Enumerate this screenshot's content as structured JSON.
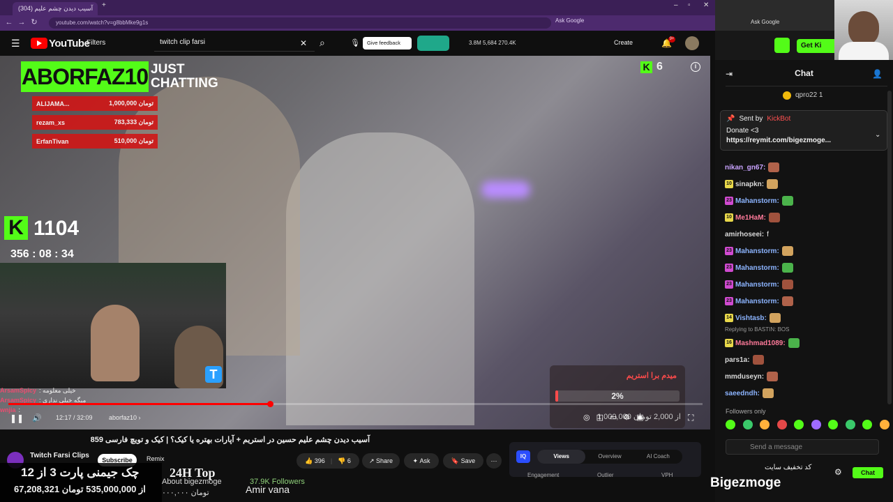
{
  "browser": {
    "tab_title": "(304) آسیب دیدن چشم عليم",
    "url": "youtube.com/watch?v=g8bbMke9g1s",
    "ask_google": "Ask Google",
    "ask_google_right": "Ask Google"
  },
  "youtube": {
    "logo_text": "YouTube",
    "filters": "Filters",
    "search_value": "twitch clip farsi",
    "feedback": "Give feedback",
    "stats": "3.8M   5,684   270.4K",
    "create": "Create",
    "notif_count": "9+"
  },
  "video": {
    "banner_name": "ABORFAZ10",
    "banner_category": "JUST CHATTING",
    "donors": [
      {
        "name": "ALIJAMA...",
        "amount": "1,000,000 تومان"
      },
      {
        "name": "rezam_xs",
        "amount": "783,333 تومان"
      },
      {
        "name": "ErfanTivan",
        "amount": "510,000 تومان"
      }
    ],
    "viewer_count": "1104",
    "timer": "356 : 08 : 34",
    "kick_viewers": "6",
    "overlay_chat": [
      {
        "user": "ArsamSpicy",
        "text": ": خیلی معلومه"
      },
      {
        "user": "ArsamSpicy",
        "text": ": میگه خیلی نداری"
      },
      {
        "user": "wnjia",
        "text": ":"
      }
    ],
    "goal_title": "میدم برا استریم",
    "goal_percent": "2%",
    "goal_progress": 0.02,
    "goal_amount": "1,000,000 از 2,000 تومان",
    "progress": 0.3764,
    "time": "12:17 / 32:09",
    "channel_chip": "aborfaz10 ›"
  },
  "below": {
    "title": "آسیب دیدن چشم علیم حسین در استریم + آپارات بهتره یا کیک؟ | کیک و تویچ فارسی 859",
    "channel": "Twitch Farsi Clips",
    "subscribe": "Subscribe",
    "remix": "Remix",
    "likes": "396",
    "dislikes": "6",
    "share": "Share",
    "ask": "Ask",
    "save": "Save",
    "vidiq_logo": "IQ",
    "vq_tabs": [
      "Views",
      "Overview",
      "AI Coach"
    ],
    "vq_engagement": "Engagement",
    "vq_outlier": "Outlier",
    "vq_vph": "VPH"
  },
  "ad": {
    "line1": "چک جیمنی پارت 3 از 12",
    "line2": "67,208,321 از 535,000,000 تومان",
    "top24": "24H Top",
    "about": "About bigezmoge",
    "followers": "37.9K Followers",
    "amir": "Amir vana",
    "toman": "۰۰۰,۰۰۰ تومان"
  },
  "kick_chat": {
    "get_kick": "Get Ki",
    "title": "Chat",
    "top_user": "qpro22",
    "top_badge": "1",
    "pinned_sent_by": "Sent by",
    "pinned_bot": "KickBot",
    "pinned_text": "Donate <3",
    "pinned_link": "https://reymit.com/bigezmoge...",
    "messages": [
      {
        "user": "nikan_gn67:",
        "cls": "u1",
        "badge": "",
        "badgeColor": "",
        "text": ""
      },
      {
        "user": "sinapkn:",
        "cls": "u4",
        "badge": "10",
        "badgeColor": "#e8d84a",
        "text": ""
      },
      {
        "user": "Mahanstorm:",
        "cls": "u2",
        "badge": "23",
        "badgeColor": "#d04ad0",
        "text": ""
      },
      {
        "user": "Me1HaM:",
        "cls": "u3",
        "badge": "10",
        "badgeColor": "#e8d84a",
        "text": ""
      },
      {
        "user": "amirhoseei:",
        "cls": "u4",
        "badge": "",
        "badgeColor": "",
        "text": "f"
      },
      {
        "user": "Mahanstorm:",
        "cls": "u2",
        "badge": "23",
        "badgeColor": "#d04ad0",
        "text": ""
      },
      {
        "user": "Mahanstorm:",
        "cls": "u2",
        "badge": "23",
        "badgeColor": "#d04ad0",
        "text": ""
      },
      {
        "user": "Mahanstorm:",
        "cls": "u2",
        "badge": "23",
        "badgeColor": "#d04ad0",
        "text": ""
      },
      {
        "user": "Mahanstorm:",
        "cls": "u2",
        "badge": "23",
        "badgeColor": "#d04ad0",
        "text": ""
      },
      {
        "user": "Vishtasb:",
        "cls": "u2",
        "badge": "14",
        "badgeColor": "#e8d84a",
        "text": ""
      },
      {
        "user": "Mashmad1089:",
        "cls": "u3",
        "badge": "16",
        "badgeColor": "#e8d84a",
        "text": ""
      },
      {
        "user": "pars1a:",
        "cls": "u4",
        "badge": "",
        "badgeColor": "",
        "text": ""
      },
      {
        "user": "mmduseyn:",
        "cls": "u4",
        "badge": "",
        "badgeColor": "",
        "text": ""
      },
      {
        "user": "saeedndh:",
        "cls": "u2",
        "badge": "",
        "badgeColor": "",
        "text": ""
      }
    ],
    "reply_note": "Replying to BASTIN: BOS",
    "followers_only": "Followers only",
    "send_placeholder": "Send a message",
    "chat_button": "Chat",
    "discount": "کد تخفیف سایت",
    "bigezmoge": "Bigezmoge"
  },
  "colors": {
    "kick_green": "#53fc18",
    "yt_red": "#ff0000",
    "browser_purple": "#4d2a6e"
  }
}
